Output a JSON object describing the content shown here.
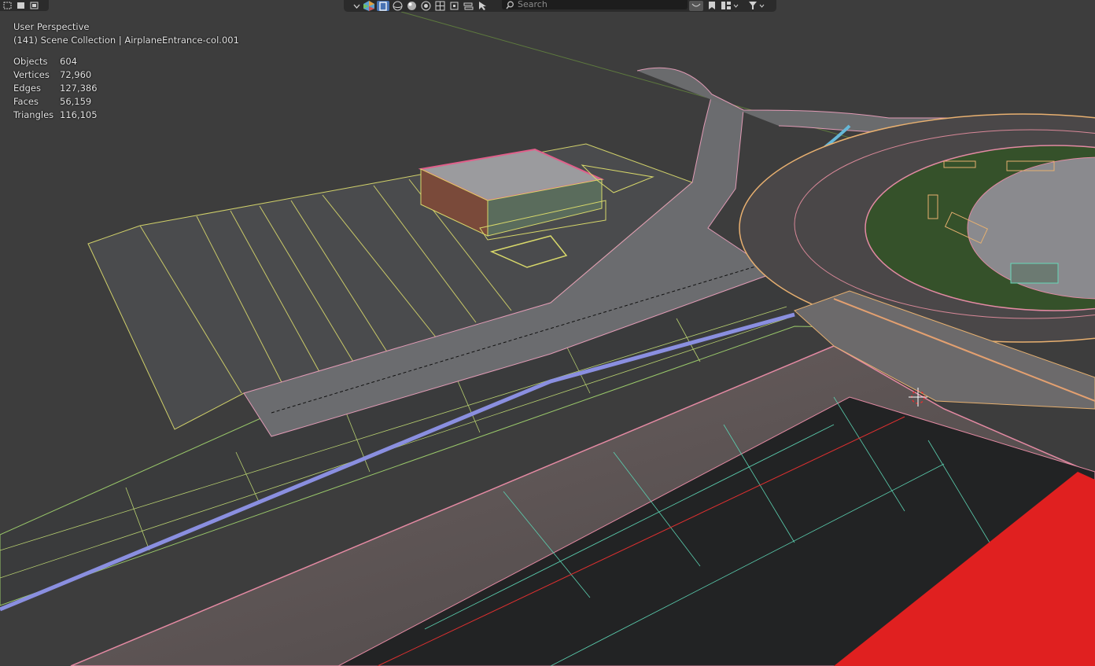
{
  "viewport": {
    "perspective_label": "User Perspective",
    "collection_label": "(141) Scene Collection | AirplaneEntrance-col.001"
  },
  "stats": [
    {
      "label": "Objects",
      "value": "604"
    },
    {
      "label": "Vertices",
      "value": "72,960"
    },
    {
      "label": "Edges",
      "value": "127,386"
    },
    {
      "label": "Faces",
      "value": "56,159"
    },
    {
      "label": "Triangles",
      "value": "116,105"
    }
  ],
  "header": {
    "search_placeholder": "Search",
    "icons": [
      "dropdown-icon",
      "color-wheel-icon",
      "select-icon",
      "sphere-icon",
      "shaded-sphere-icon",
      "render-sphere-icon",
      "grid-icon",
      "frame-icon",
      "layers-icon",
      "cursor-icon",
      "bookmark-icon",
      "view-options-icon",
      "filter-icon"
    ]
  },
  "select_modes": [
    "select-new-icon",
    "select-extend-icon",
    "select-subtract-icon"
  ],
  "colors": {
    "background": "#3d3d3d",
    "wire_pink": "#e58aa3",
    "wire_cyan": "#66d8b8",
    "wire_yellow": "#d8d86a",
    "wire_blue": "#7a86e0",
    "red_object": "#e02020"
  }
}
